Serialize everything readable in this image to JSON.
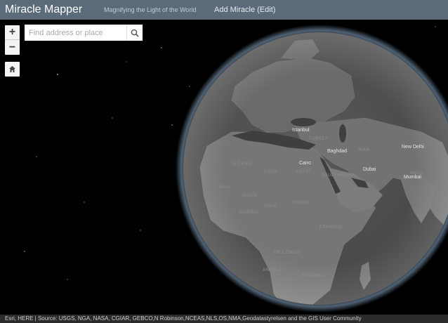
{
  "header": {
    "title": "Miracle Mapper",
    "subtitle": "Magnifying the Light of the World",
    "nav_link": "Add Miracle (Edit)"
  },
  "controls": {
    "zoom_in": "+",
    "zoom_out": "−"
  },
  "search": {
    "placeholder": "Find address or place",
    "value": ""
  },
  "map": {
    "countries": [
      "LIBYA",
      "EGYPT",
      "SAUDI ARABIA",
      "IRAN",
      "TURKEY",
      "CHAD",
      "SUDAN",
      "NIGER",
      "MALI",
      "NIGERIA",
      "ETHIOPIA",
      "DR CONGO",
      "TANZANIA",
      "ANGOLA",
      "ALGERIA",
      "INDIA"
    ],
    "cities": [
      "Istanbul",
      "Baghdad",
      "Cairo",
      "Dubai",
      "New Delhi",
      "Mumbai"
    ]
  },
  "attribution": "Esri, HERE | Source: USGS, NGA, NASA, CGIAR, GEBCO,N Robinson,NCEAS,NLS,OS,NMA,Geodatastyrelsen and the GIS User Community",
  "colors": {
    "header_bg": "#5b6b7a",
    "globe_ocean": "#4d4d4d",
    "globe_land": "#707070",
    "globe_glow": "#9ec3e6"
  }
}
